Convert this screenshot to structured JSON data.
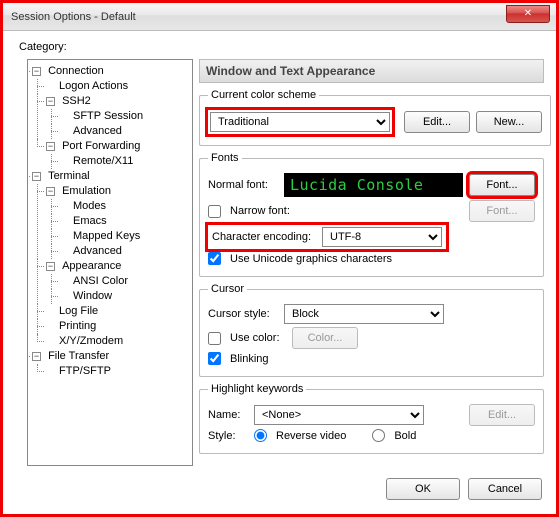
{
  "window": {
    "title": "Session Options - Default"
  },
  "category_label": "Category:",
  "tree": {
    "connection": "Connection",
    "logon_actions": "Logon Actions",
    "ssh2": "SSH2",
    "sftp_session": "SFTP Session",
    "advanced1": "Advanced",
    "port_fwd": "Port Forwarding",
    "remote_x11": "Remote/X11",
    "terminal": "Terminal",
    "emulation": "Emulation",
    "modes": "Modes",
    "emacs": "Emacs",
    "mapped_keys": "Mapped Keys",
    "advanced2": "Advanced",
    "appearance": "Appearance",
    "ansi_color": "ANSI Color",
    "window": "Window",
    "logfile": "Log File",
    "printing": "Printing",
    "xyzmodem": "X/Y/Zmodem",
    "file_transfer": "File Transfer",
    "ftp_sftp": "FTP/SFTP"
  },
  "section_title": "Window and Text Appearance",
  "color_scheme": {
    "legend": "Current color scheme",
    "value": "Traditional",
    "edit_btn": "Edit...",
    "new_btn": "New..."
  },
  "fonts": {
    "legend": "Fonts",
    "normal_label": "Normal font:",
    "preview": "Lucida Console",
    "font_btn": "Font...",
    "narrow_label": "Narrow font:",
    "narrow_checked": false,
    "font_btn2": "Font...",
    "encoding_label": "Character encoding:",
    "encoding_value": "UTF-8",
    "unicode_label": "Use Unicode graphics characters",
    "unicode_checked": true
  },
  "cursor": {
    "legend": "Cursor",
    "style_label": "Cursor style:",
    "style_value": "Block",
    "use_color_label": "Use color:",
    "use_color_checked": false,
    "color_btn": "Color...",
    "blinking_label": "Blinking",
    "blinking_checked": true
  },
  "highlight": {
    "legend": "Highlight keywords",
    "name_label": "Name:",
    "name_value": "<None>",
    "edit_btn": "Edit...",
    "style_label": "Style:",
    "reverse_label": "Reverse video",
    "bold_label": "Bold"
  },
  "buttons": {
    "ok": "OK",
    "cancel": "Cancel"
  },
  "exp_minus": "−"
}
